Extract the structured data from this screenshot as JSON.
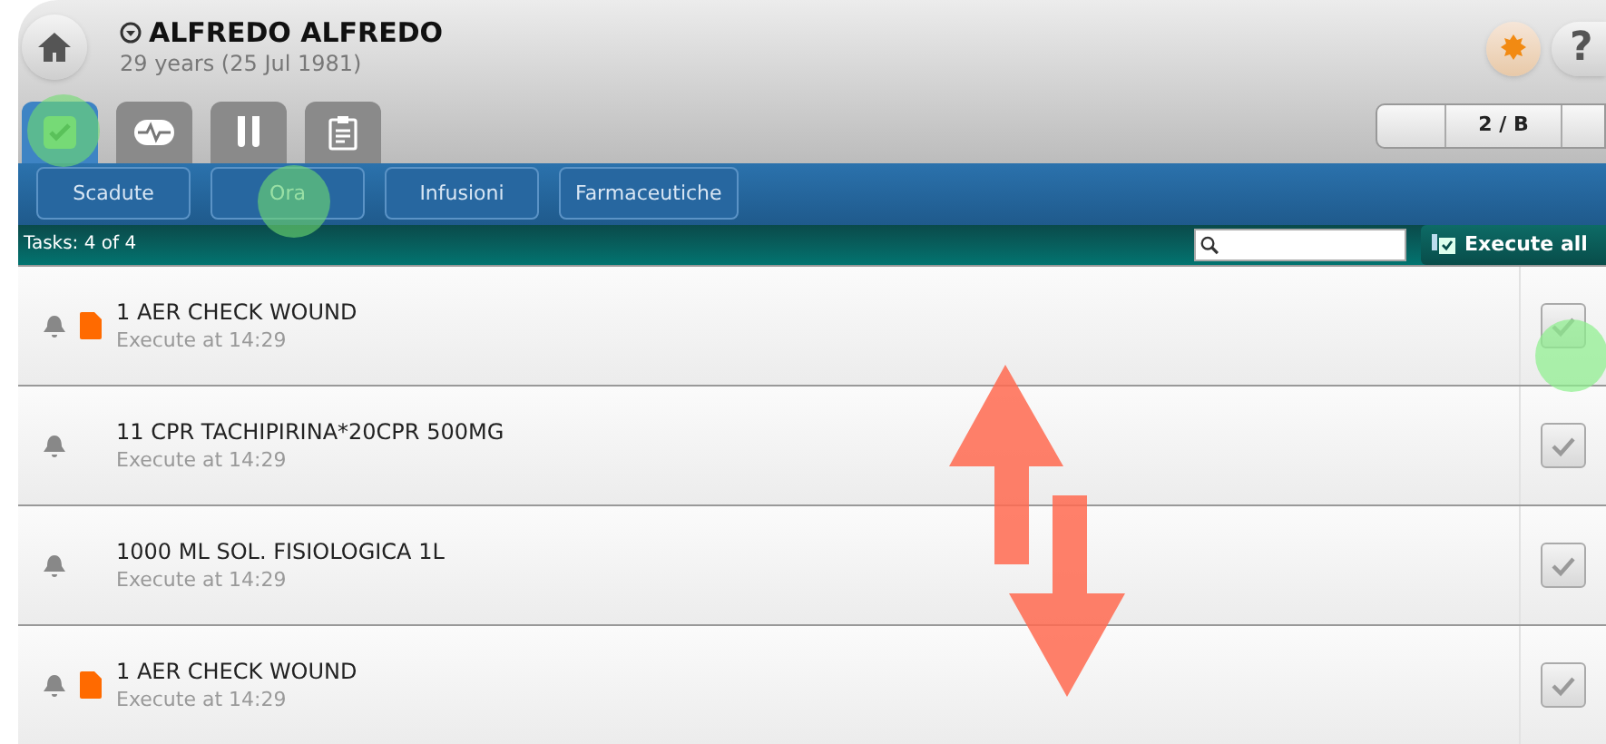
{
  "patient": {
    "name": "ALFREDO ALFREDO",
    "age": "29 years (25 Jul 1981)"
  },
  "tabs": [
    {
      "kind": "check",
      "selected": true
    },
    {
      "kind": "vitals",
      "selected": false
    },
    {
      "kind": "tubes",
      "selected": false
    },
    {
      "kind": "clipboard",
      "selected": false
    }
  ],
  "location": {
    "label": "2 / B"
  },
  "help_label": "?",
  "filters": [
    {
      "label": "Scadute",
      "selected": false
    },
    {
      "label": "Ora",
      "selected": false
    },
    {
      "label": "Infusioni",
      "selected": false
    },
    {
      "label": "Farmaceutiche",
      "selected": false
    }
  ],
  "task_count": "Tasks: 4 of  4",
  "execute_all": "Execute all",
  "tasks": [
    {
      "title": "1 AER CHECK WOUND",
      "time": "Execute at 14:29",
      "has_document": true
    },
    {
      "title": "11 CPR TACHIPIRINA*20CPR 500MG",
      "time": "Execute at 14:29",
      "has_document": false
    },
    {
      "title": "1000 ML SOL. FISIOLOGICA 1L",
      "time": "Execute at 14:29",
      "has_document": false
    },
    {
      "title": "1 AER CHECK WOUND",
      "time": "Execute at 14:29",
      "has_document": true
    }
  ]
}
